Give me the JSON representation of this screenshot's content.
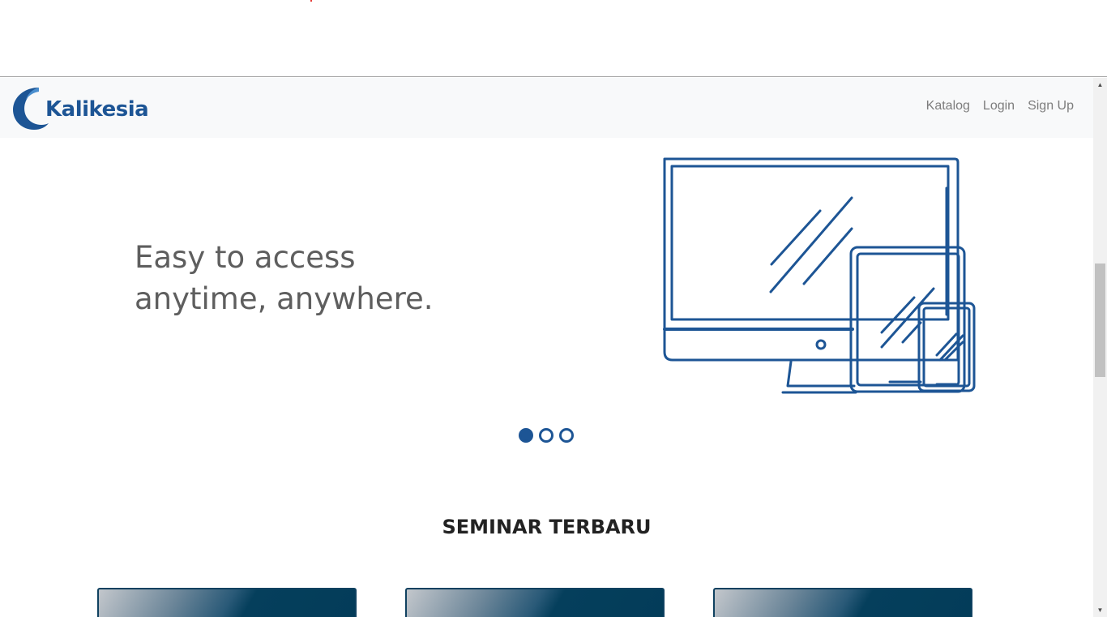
{
  "navbar": {
    "brand": "Kalikesia",
    "links": [
      "Katalog",
      "Login",
      "Sign Up"
    ]
  },
  "hero": {
    "line1": "Easy to access",
    "line2": "anytime, anywhere."
  },
  "carousel": {
    "slides": 3,
    "active": 1
  },
  "section": {
    "title": "SEMINAR TERBARU"
  },
  "colors": {
    "brand": "#1d5595",
    "nav_bg": "#f8f9fa",
    "card_dark": "#033c59"
  },
  "icons": [
    "logo-wave-icon",
    "devices-illustration",
    "scroll-up-icon",
    "scroll-down-icon"
  ]
}
